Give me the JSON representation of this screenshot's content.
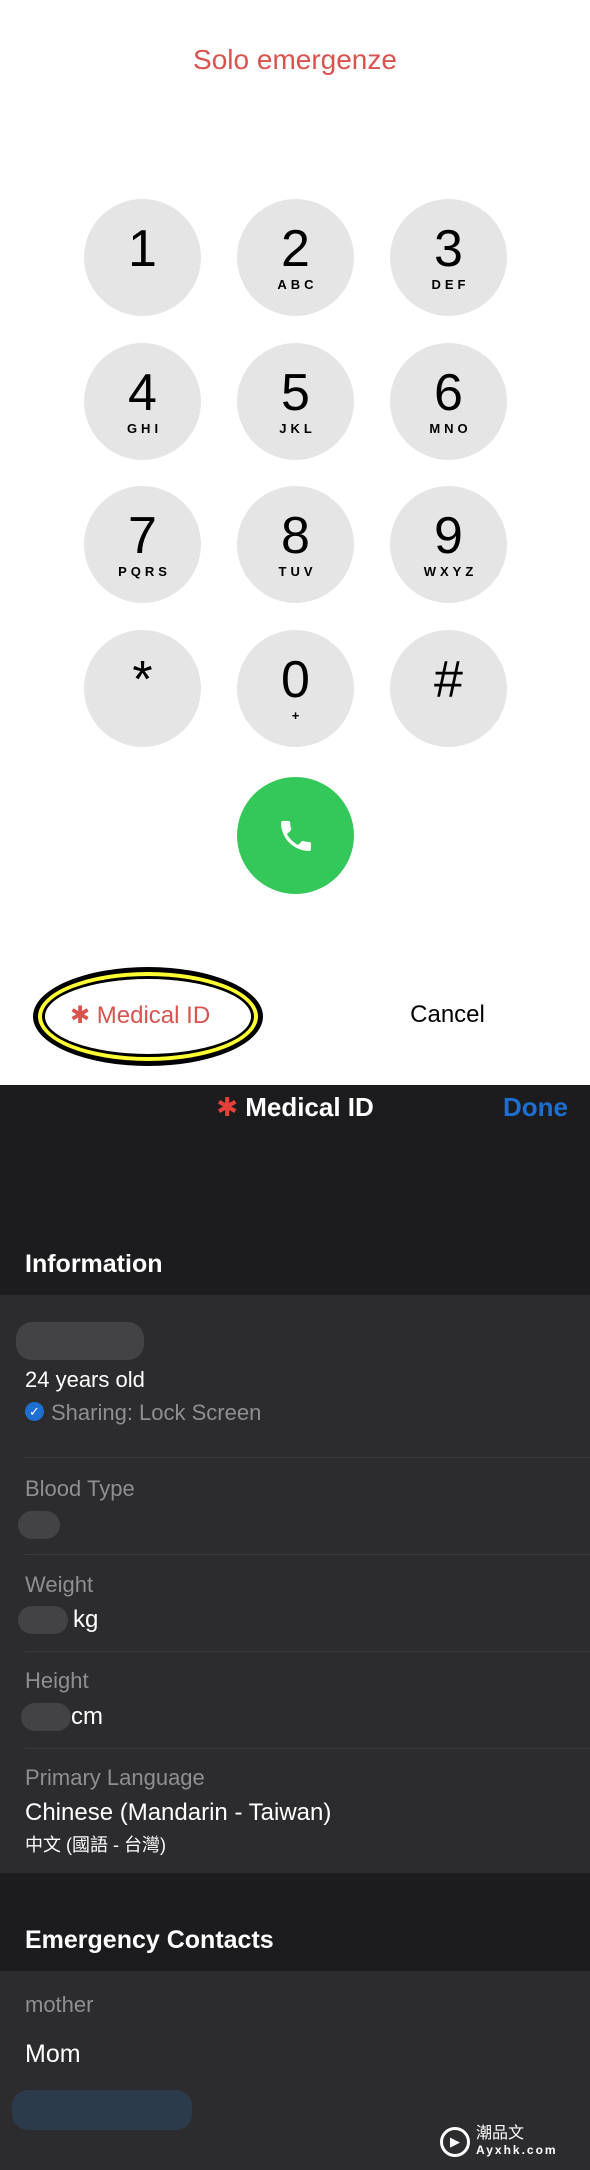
{
  "dialer": {
    "title": "Solo emergenze",
    "keys": [
      {
        "digit": "1",
        "letters": ""
      },
      {
        "digit": "2",
        "letters": "ABC"
      },
      {
        "digit": "3",
        "letters": "DEF"
      },
      {
        "digit": "4",
        "letters": "GHI"
      },
      {
        "digit": "5",
        "letters": "JKL"
      },
      {
        "digit": "6",
        "letters": "MNO"
      },
      {
        "digit": "7",
        "letters": "PQRS"
      },
      {
        "digit": "8",
        "letters": "TUV"
      },
      {
        "digit": "9",
        "letters": "WXYZ"
      },
      {
        "digit": "*",
        "letters": ""
      },
      {
        "digit": "0",
        "letters": "+"
      },
      {
        "digit": "#",
        "letters": ""
      }
    ],
    "medical_id_label": "Medical ID",
    "cancel_label": "Cancel",
    "highlight_color": "#ffff33",
    "call_color": "#34c759"
  },
  "medical_id": {
    "title": "Medical ID",
    "done_label": "Done",
    "information_header": "Information",
    "age": "24 years old",
    "sharing": "Sharing: Lock Screen",
    "blood_type_label": "Blood Type",
    "weight_label": "Weight",
    "weight_unit": "kg",
    "height_label": "Height",
    "height_unit": "cm",
    "language_label": "Primary Language",
    "language_value": "Chinese (Mandarin - Taiwan)",
    "language_native": "中文 (國語 - 台灣)",
    "emergency_header": "Emergency Contacts",
    "contact_relation": "mother",
    "contact_name": "Mom"
  },
  "watermark": {
    "text": "潮品文",
    "site": "Ayxhk.com"
  }
}
